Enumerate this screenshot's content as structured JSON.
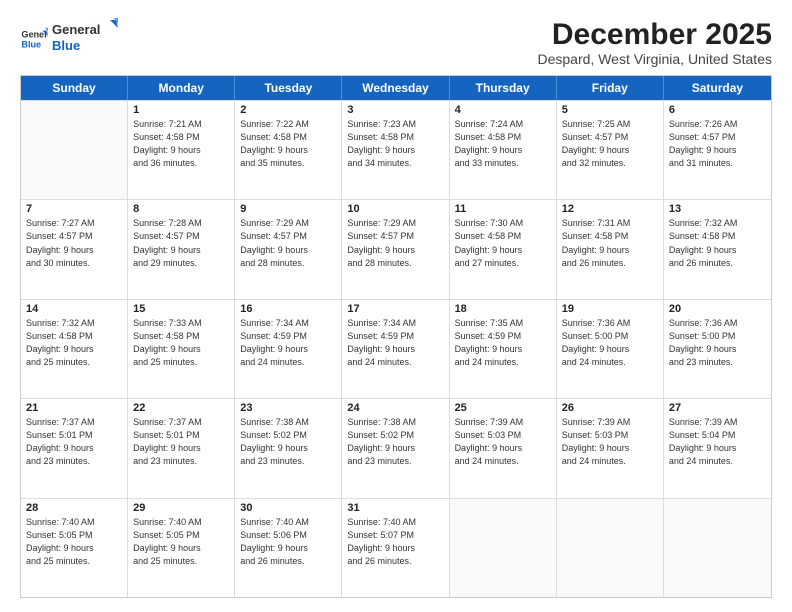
{
  "header": {
    "logo_line1": "General",
    "logo_line2": "Blue",
    "month": "December 2025",
    "location": "Despard, West Virginia, United States"
  },
  "days_of_week": [
    "Sunday",
    "Monday",
    "Tuesday",
    "Wednesday",
    "Thursday",
    "Friday",
    "Saturday"
  ],
  "weeks": [
    [
      {
        "day": "",
        "info": ""
      },
      {
        "day": "1",
        "info": "Sunrise: 7:21 AM\nSunset: 4:58 PM\nDaylight: 9 hours\nand 36 minutes."
      },
      {
        "day": "2",
        "info": "Sunrise: 7:22 AM\nSunset: 4:58 PM\nDaylight: 9 hours\nand 35 minutes."
      },
      {
        "day": "3",
        "info": "Sunrise: 7:23 AM\nSunset: 4:58 PM\nDaylight: 9 hours\nand 34 minutes."
      },
      {
        "day": "4",
        "info": "Sunrise: 7:24 AM\nSunset: 4:58 PM\nDaylight: 9 hours\nand 33 minutes."
      },
      {
        "day": "5",
        "info": "Sunrise: 7:25 AM\nSunset: 4:57 PM\nDaylight: 9 hours\nand 32 minutes."
      },
      {
        "day": "6",
        "info": "Sunrise: 7:26 AM\nSunset: 4:57 PM\nDaylight: 9 hours\nand 31 minutes."
      }
    ],
    [
      {
        "day": "7",
        "info": "Sunrise: 7:27 AM\nSunset: 4:57 PM\nDaylight: 9 hours\nand 30 minutes."
      },
      {
        "day": "8",
        "info": "Sunrise: 7:28 AM\nSunset: 4:57 PM\nDaylight: 9 hours\nand 29 minutes."
      },
      {
        "day": "9",
        "info": "Sunrise: 7:29 AM\nSunset: 4:57 PM\nDaylight: 9 hours\nand 28 minutes."
      },
      {
        "day": "10",
        "info": "Sunrise: 7:29 AM\nSunset: 4:57 PM\nDaylight: 9 hours\nand 28 minutes."
      },
      {
        "day": "11",
        "info": "Sunrise: 7:30 AM\nSunset: 4:58 PM\nDaylight: 9 hours\nand 27 minutes."
      },
      {
        "day": "12",
        "info": "Sunrise: 7:31 AM\nSunset: 4:58 PM\nDaylight: 9 hours\nand 26 minutes."
      },
      {
        "day": "13",
        "info": "Sunrise: 7:32 AM\nSunset: 4:58 PM\nDaylight: 9 hours\nand 26 minutes."
      }
    ],
    [
      {
        "day": "14",
        "info": "Sunrise: 7:32 AM\nSunset: 4:58 PM\nDaylight: 9 hours\nand 25 minutes."
      },
      {
        "day": "15",
        "info": "Sunrise: 7:33 AM\nSunset: 4:58 PM\nDaylight: 9 hours\nand 25 minutes."
      },
      {
        "day": "16",
        "info": "Sunrise: 7:34 AM\nSunset: 4:59 PM\nDaylight: 9 hours\nand 24 minutes."
      },
      {
        "day": "17",
        "info": "Sunrise: 7:34 AM\nSunset: 4:59 PM\nDaylight: 9 hours\nand 24 minutes."
      },
      {
        "day": "18",
        "info": "Sunrise: 7:35 AM\nSunset: 4:59 PM\nDaylight: 9 hours\nand 24 minutes."
      },
      {
        "day": "19",
        "info": "Sunrise: 7:36 AM\nSunset: 5:00 PM\nDaylight: 9 hours\nand 24 minutes."
      },
      {
        "day": "20",
        "info": "Sunrise: 7:36 AM\nSunset: 5:00 PM\nDaylight: 9 hours\nand 23 minutes."
      }
    ],
    [
      {
        "day": "21",
        "info": "Sunrise: 7:37 AM\nSunset: 5:01 PM\nDaylight: 9 hours\nand 23 minutes."
      },
      {
        "day": "22",
        "info": "Sunrise: 7:37 AM\nSunset: 5:01 PM\nDaylight: 9 hours\nand 23 minutes."
      },
      {
        "day": "23",
        "info": "Sunrise: 7:38 AM\nSunset: 5:02 PM\nDaylight: 9 hours\nand 23 minutes."
      },
      {
        "day": "24",
        "info": "Sunrise: 7:38 AM\nSunset: 5:02 PM\nDaylight: 9 hours\nand 23 minutes."
      },
      {
        "day": "25",
        "info": "Sunrise: 7:39 AM\nSunset: 5:03 PM\nDaylight: 9 hours\nand 24 minutes."
      },
      {
        "day": "26",
        "info": "Sunrise: 7:39 AM\nSunset: 5:03 PM\nDaylight: 9 hours\nand 24 minutes."
      },
      {
        "day": "27",
        "info": "Sunrise: 7:39 AM\nSunset: 5:04 PM\nDaylight: 9 hours\nand 24 minutes."
      }
    ],
    [
      {
        "day": "28",
        "info": "Sunrise: 7:40 AM\nSunset: 5:05 PM\nDaylight: 9 hours\nand 25 minutes."
      },
      {
        "day": "29",
        "info": "Sunrise: 7:40 AM\nSunset: 5:05 PM\nDaylight: 9 hours\nand 25 minutes."
      },
      {
        "day": "30",
        "info": "Sunrise: 7:40 AM\nSunset: 5:06 PM\nDaylight: 9 hours\nand 26 minutes."
      },
      {
        "day": "31",
        "info": "Sunrise: 7:40 AM\nSunset: 5:07 PM\nDaylight: 9 hours\nand 26 minutes."
      },
      {
        "day": "",
        "info": ""
      },
      {
        "day": "",
        "info": ""
      },
      {
        "day": "",
        "info": ""
      }
    ]
  ]
}
